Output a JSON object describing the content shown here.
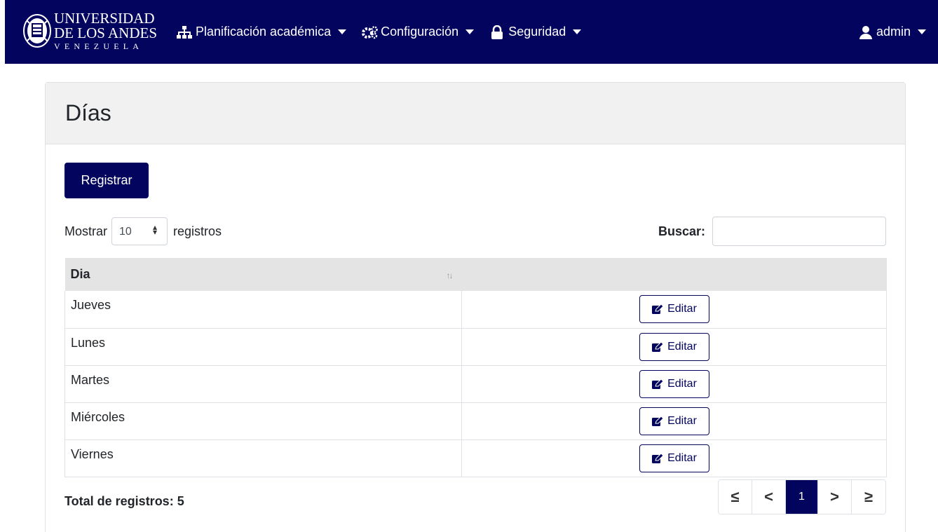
{
  "brand": {
    "line1": "UNIVERSIDAD",
    "line2": "DE LOS ANDES",
    "line3": "VENEZUELA"
  },
  "nav": {
    "items": [
      {
        "label": "Planificación académica",
        "icon": "sitemap-icon"
      },
      {
        "label": "Configuración",
        "icon": "cogs-icon"
      },
      {
        "label": "Seguridad",
        "icon": "lock-icon"
      }
    ],
    "user": {
      "label": "admin",
      "icon": "user-icon"
    }
  },
  "page": {
    "title": "Días",
    "register_label": "Registrar"
  },
  "length_menu": {
    "prefix": "Mostrar",
    "value": "10",
    "suffix": "registros"
  },
  "search": {
    "label": "Buscar:",
    "value": ""
  },
  "table": {
    "headers": [
      "Dia",
      ""
    ],
    "rows": [
      {
        "day": "Jueves",
        "action": "Editar"
      },
      {
        "day": "Lunes",
        "action": "Editar"
      },
      {
        "day": "Martes",
        "action": "Editar"
      },
      {
        "day": "Miércoles",
        "action": "Editar"
      },
      {
        "day": "Viernes",
        "action": "Editar"
      }
    ]
  },
  "footer": {
    "total": "Total de registros: 5"
  },
  "pagination": {
    "first": "≤",
    "prev": "<",
    "current": "1",
    "next": ">",
    "last": "≥"
  },
  "colors": {
    "primary": "#03045e",
    "header_bg": "#f1f1f1",
    "table_head_bg": "#e4e4e4"
  }
}
